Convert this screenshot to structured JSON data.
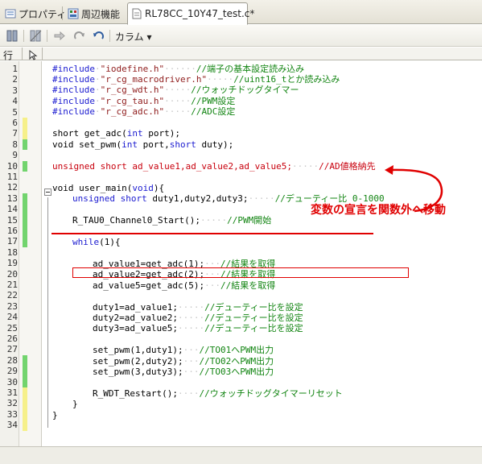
{
  "tabs": [
    {
      "label": "プロパティ",
      "icon": "properties-icon",
      "active": false
    },
    {
      "label": "周辺機能",
      "icon": "peripheral-icon",
      "active": false
    },
    {
      "label": "RL78CC_10Y47_test.c*",
      "icon": "source-file-icon",
      "active": true
    }
  ],
  "toolbar": {
    "column_menu_label": "カラム ▾",
    "buttons": [
      "bookmark-icon",
      "bookmark-clear-icon",
      "forward-icon",
      "redo-icon",
      "undo-icon"
    ]
  },
  "ruler": {
    "label": "行"
  },
  "line_numbers": [
    "1",
    "2",
    "3",
    "4",
    "5",
    "6",
    "7",
    "8",
    "9",
    "10",
    "11",
    "12",
    "13",
    "14",
    "15",
    "16",
    "17",
    "18",
    "19",
    "20",
    "21",
    "22",
    "23",
    "24",
    "25",
    "26",
    "27",
    "28",
    "29",
    "30",
    "31",
    "32",
    "33",
    "34"
  ],
  "markers": [
    "none",
    "none",
    "none",
    "none",
    "none",
    "yellow",
    "yellow",
    "green",
    "none",
    "green",
    "none",
    "none",
    "green",
    "green",
    "green",
    "green",
    "green",
    "none",
    "none",
    "none",
    "none",
    "none",
    "none",
    "none",
    "none",
    "none",
    "none",
    "green",
    "green",
    "green",
    "yellow",
    "yellow",
    "yellow",
    "yellow"
  ],
  "code": {
    "l1": {
      "pp": "#include",
      "str": "\"iodefine.h\"",
      "cm": "//端子の基本設定読み込み"
    },
    "l2": {
      "pp": "#include",
      "str": "\"r_cg_macrodriver.h\"",
      "cm": "//uint16_tとか読み込み"
    },
    "l3": {
      "pp": "#include",
      "str": "\"r_cg_wdt.h\"",
      "cm": "//ウォッチドッグタイマー"
    },
    "l4": {
      "pp": "#include",
      "str": "\"r_cg_tau.h\"",
      "cm": "//PWM設定"
    },
    "l5": {
      "pp": "#include",
      "str": "\"r_cg_adc.h\"",
      "cm": "//ADC設定"
    },
    "l7": {
      "pre": "short get_adc(",
      "kw": "int",
      "post": " port);"
    },
    "l8": {
      "pre": "void set_pwm(",
      "kw1": "int",
      "mid": " port,",
      "kw2": "short",
      "post": " duty);"
    },
    "l10": {
      "kw": "unsigned short",
      "rest": " ad_value1,ad_value2,ad_value5;",
      "cm": "//AD値格納先"
    },
    "l12": {
      "pre": "void user_main(",
      "kw": "void",
      "post": "){"
    },
    "l13": {
      "kw": "unsigned short",
      "rest": " duty1,duty2,duty3;",
      "cm": "//デューティー比 0-1000"
    },
    "l15": {
      "text": "R_TAU0_Channel0_Start();",
      "cm": "//PWM開始"
    },
    "l17": {
      "kw": "while",
      "post": "(1){"
    },
    "l19": {
      "text": "ad_value1=get_adc(1);",
      "cm": "//結果を取得"
    },
    "l20": {
      "text": "ad_value2=get_adc(2);",
      "cm": "//結果を取得"
    },
    "l21": {
      "text": "ad_value5=get_adc(5);",
      "cm": "//結果を取得"
    },
    "l23": {
      "text": "duty1=ad_value1;",
      "cm": "//デューティー比を設定"
    },
    "l24": {
      "text": "duty2=ad_value2;",
      "cm": "//デューティー比を設定"
    },
    "l25": {
      "text": "duty3=ad_value5;",
      "cm": "//デューティー比を設定"
    },
    "l27": {
      "text": "set_pwm(1,duty1);",
      "cm": "//TO01へPWM出力"
    },
    "l28": {
      "text": "set_pwm(2,duty2);",
      "cm": "//TO02へPWM出力"
    },
    "l29": {
      "text": "set_pwm(3,duty3);",
      "cm": "//TO03へPWM出力"
    },
    "l31": {
      "text": "R_WDT_Restart();",
      "cm": "//ウォッチドッグタイマーリセット"
    },
    "l32": {
      "text": "}"
    },
    "l33": {
      "text": "}"
    }
  },
  "annotation": {
    "text": "変数の宣言を関数外へ移動",
    "color": "#e00000"
  },
  "colors": {
    "keyword": "#1b1bd0",
    "string": "#8f1c1c",
    "comment": "#138513",
    "annotation": "#e00000"
  }
}
